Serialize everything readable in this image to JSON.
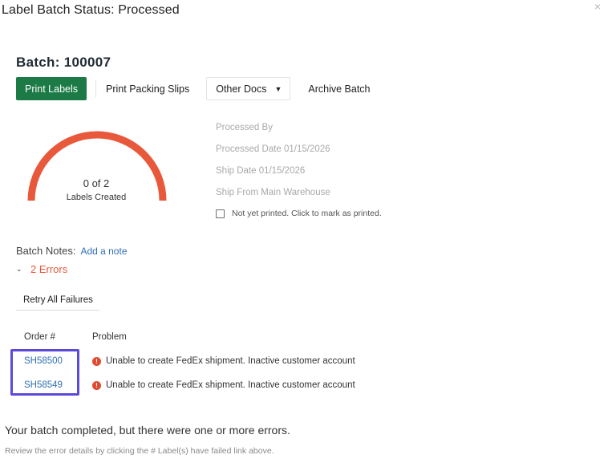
{
  "modal": {
    "title": "Label Batch Status: Processed",
    "close_glyph": "×"
  },
  "batch": {
    "title": "Batch: 100007"
  },
  "toolbar": {
    "print_labels": "Print Labels",
    "print_packing_slips": "Print Packing Slips",
    "other_docs": "Other Docs",
    "archive_batch": "Archive Batch"
  },
  "gauge": {
    "created": 0,
    "total": 2,
    "count_text": "0 of 2",
    "label": "Labels Created",
    "color": "#e8593c"
  },
  "meta": {
    "processed_by": "Processed By",
    "processed_date": "Processed Date 01/15/2026",
    "ship_date": "Ship Date 01/15/2026",
    "ship_from": "Ship From Main Warehouse",
    "print_check_label": "Not yet printed. Click to mark as printed."
  },
  "notes": {
    "label": "Batch Notes:",
    "add_link": "Add a note"
  },
  "errors": {
    "toggle_label": "2 Errors",
    "retry_button": "Retry All Failures"
  },
  "table": {
    "headers": {
      "order": "Order #",
      "problem": "Problem"
    },
    "rows": [
      {
        "order": "SH58500",
        "problem": "Unable to create FedEx shipment. Inactive customer account"
      },
      {
        "order": "SH58549",
        "problem": "Unable to create FedEx shipment. Inactive customer account"
      }
    ]
  },
  "summary": {
    "message": "Your batch completed, but there were one or more errors.",
    "detail": "Review the error details by clicking the # Label(s) have failed link above."
  },
  "colors": {
    "primary": "#1b7a45",
    "error": "#e8593c",
    "link": "#2f6fb6",
    "highlight": "#5b4bd8"
  }
}
